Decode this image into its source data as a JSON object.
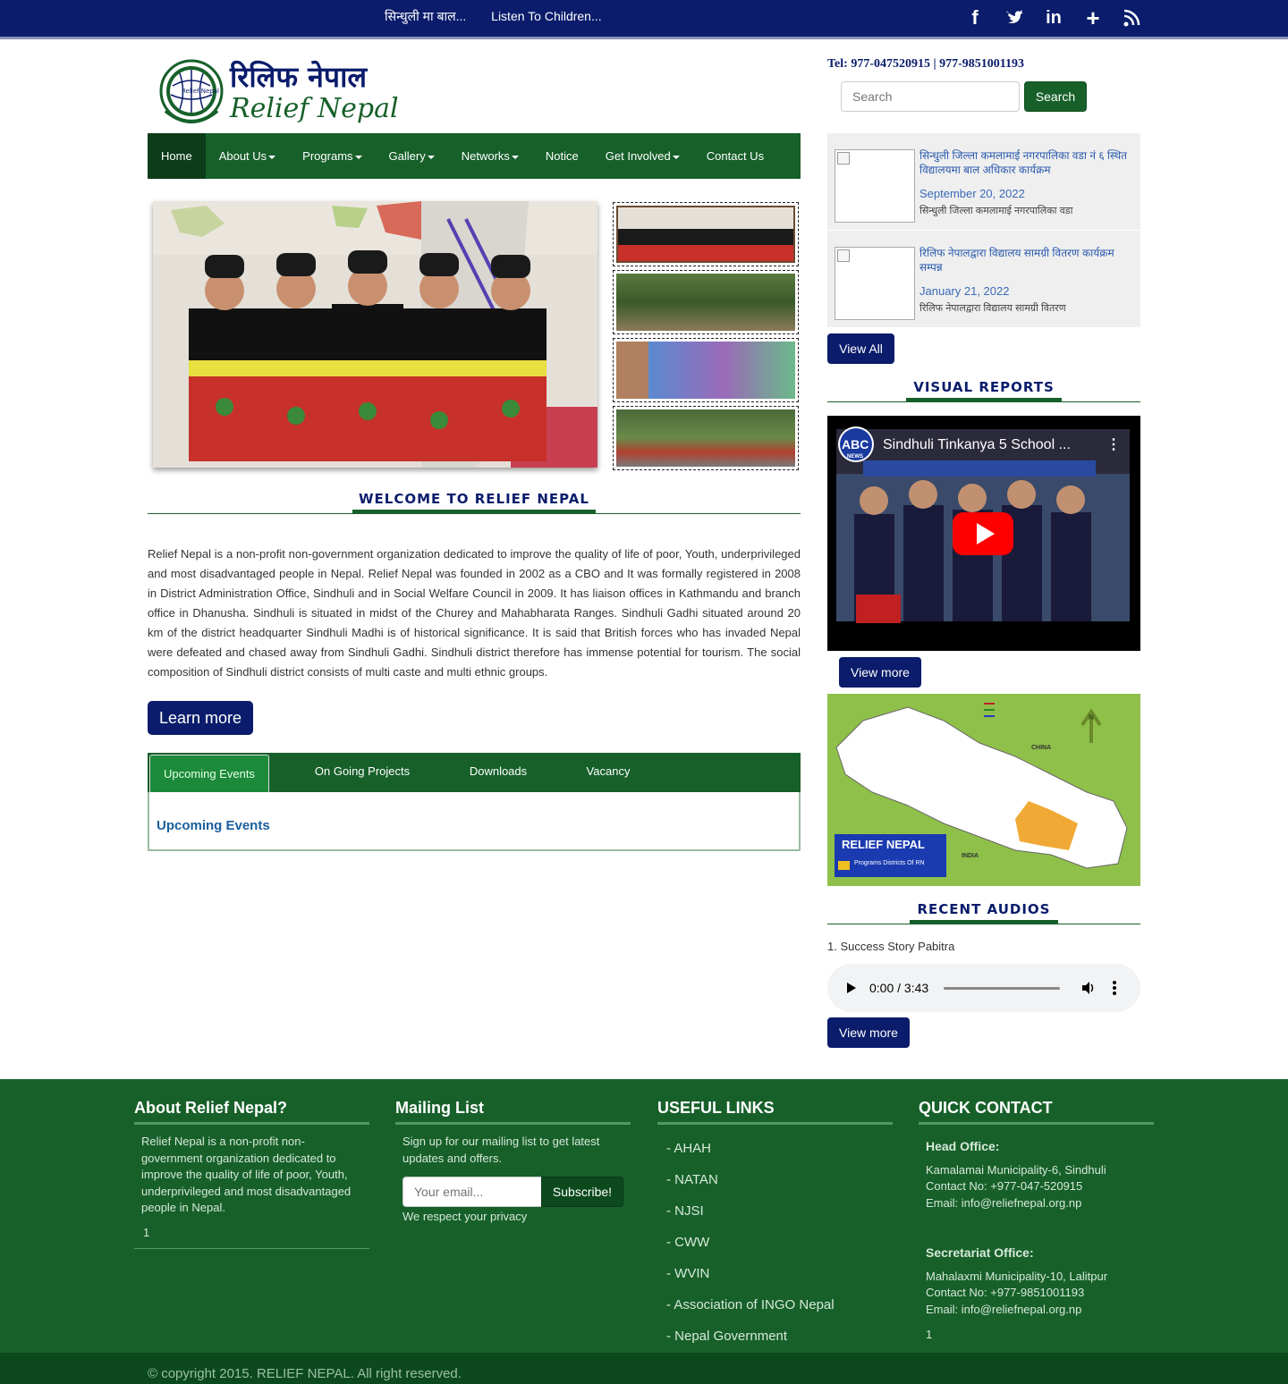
{
  "topbar": {
    "marquee": [
      "सिन्धुली मा बाल...",
      "Listen To Children..."
    ],
    "social_icons": [
      "facebook-icon",
      "twitter-icon",
      "linkedin-icon",
      "google-plus-icon",
      "rss-icon"
    ]
  },
  "header": {
    "logo_nepali": "रिलिफ नेपाल",
    "logo_english": "Relief Nepal",
    "logo_badge": "Relief Nepal",
    "tel": "Tel: 977-047520915 | 977-9851001193",
    "search_placeholder": "Search",
    "search_button": "Search"
  },
  "nav": {
    "items": [
      {
        "label": "Home",
        "dropdown": false,
        "active": true
      },
      {
        "label": "About Us",
        "dropdown": true
      },
      {
        "label": "Programs",
        "dropdown": true
      },
      {
        "label": "Gallery",
        "dropdown": true
      },
      {
        "label": "Networks",
        "dropdown": true
      },
      {
        "label": "Notice",
        "dropdown": false
      },
      {
        "label": "Get Involved",
        "dropdown": true
      },
      {
        "label": "Contact Us",
        "dropdown": false
      }
    ]
  },
  "welcome": {
    "title": "WELCOME TO RELIEF NEPAL",
    "text": "Relief Nepal is a non-profit non-government organization dedicated to improve the quality of life of poor, Youth, underprivileged and most disadvantaged people in Nepal. Relief Nepal was founded in 2002 as a CBO and It was formally registered in 2008 in District Administration Office, Sindhuli and in Social Welfare Council in 2009. It has liaison offices in Kathmandu and branch office in Dhanusha. Sindhuli is situated in midst of the Churey and Mahabharata Ranges. Sindhuli Gadhi situated around 20 km of the district headquarter Sindhuli Madhi is of historical significance. It is said that British forces who has invaded Nepal were defeated and chased away from Sindhuli Gadhi. Sindhuli district therefore has immense potential for tourism. The social composition of Sindhuli district consists of multi caste and multi ethnic groups.",
    "button": "Learn more"
  },
  "tabs": {
    "items": [
      "Upcoming Events",
      "On Going Projects",
      "Downloads",
      "Vacancy"
    ],
    "panel_heading": "Upcoming Events"
  },
  "news": {
    "items": [
      {
        "title": "सिन्धुली जिल्ला कमलामाई नगरपालिका वडा नं ६ स्थित विद्यालयमा बाल अधिकार कार्यक्रम",
        "date": "September 20, 2022",
        "desc": "सिन्धुली जिल्ला कमलामाई नगरपालिका वडा"
      },
      {
        "title": "रिलिफ नेपालद्वारा विद्यालय सामग्री वितरण कार्यक्रम सम्पन्न",
        "date": "January 21, 2022",
        "desc": "रिलिफ नेपालद्वारा विद्यालय सामग्री वितरण"
      }
    ],
    "view_all": "View All"
  },
  "visual_reports": {
    "title": "VISUAL REPORTS",
    "video_title": "Sindhuli Tinkanya 5 School ...",
    "video_logo": "ABC",
    "video_logo_sub": "NEWS",
    "view_more": "View more"
  },
  "map": {
    "label": "RELIEF NEPAL",
    "legend": "Programs Districts Of RN",
    "china": "CHINA",
    "india": "INDIA",
    "north": "N"
  },
  "audios": {
    "title": "RECENT AUDIOS",
    "item": "1. Success Story Pabitra",
    "time": "0:00 / 3:43",
    "view_more": "View more"
  },
  "footer": {
    "about": {
      "heading": "About Relief Nepal?",
      "text": "Relief Nepal is a non-profit non-government organization dedicated to improve the quality of life of poor, Youth, underprivileged and most disadvantaged people in Nepal.",
      "count": "1"
    },
    "mailing": {
      "heading": "Mailing List",
      "text": "Sign up for our mailing list to get latest updates and offers.",
      "placeholder": "Your email...",
      "button": "Subscribe!",
      "privacy": "We respect your privacy"
    },
    "links": {
      "heading": "USEFUL LINKS",
      "items": [
        "- AHAH",
        "- NATAN",
        "- NJSI",
        "- CWW",
        "- WVIN",
        "- Association of INGO Nepal",
        "- Nepal Government"
      ]
    },
    "contact": {
      "heading": "QUICK CONTACT",
      "head_label": "Head Office:",
      "head_address": "Kamalamai Municipality-6, Sindhuli",
      "head_phone": "Contact No: +977-047-520915",
      "head_email": "Email: info@reliefnepal.org.np",
      "sec_label": "Secretariat Office:",
      "sec_address": "Mahalaxmi Municipality-10, Lalitpur",
      "sec_phone": "Contact No: +977-9851001193",
      "sec_email": "Email: info@reliefnepal.org.np",
      "count": "1"
    },
    "copyright": "© copyright 2015. RELIEF NEPAL. All right reserved."
  }
}
